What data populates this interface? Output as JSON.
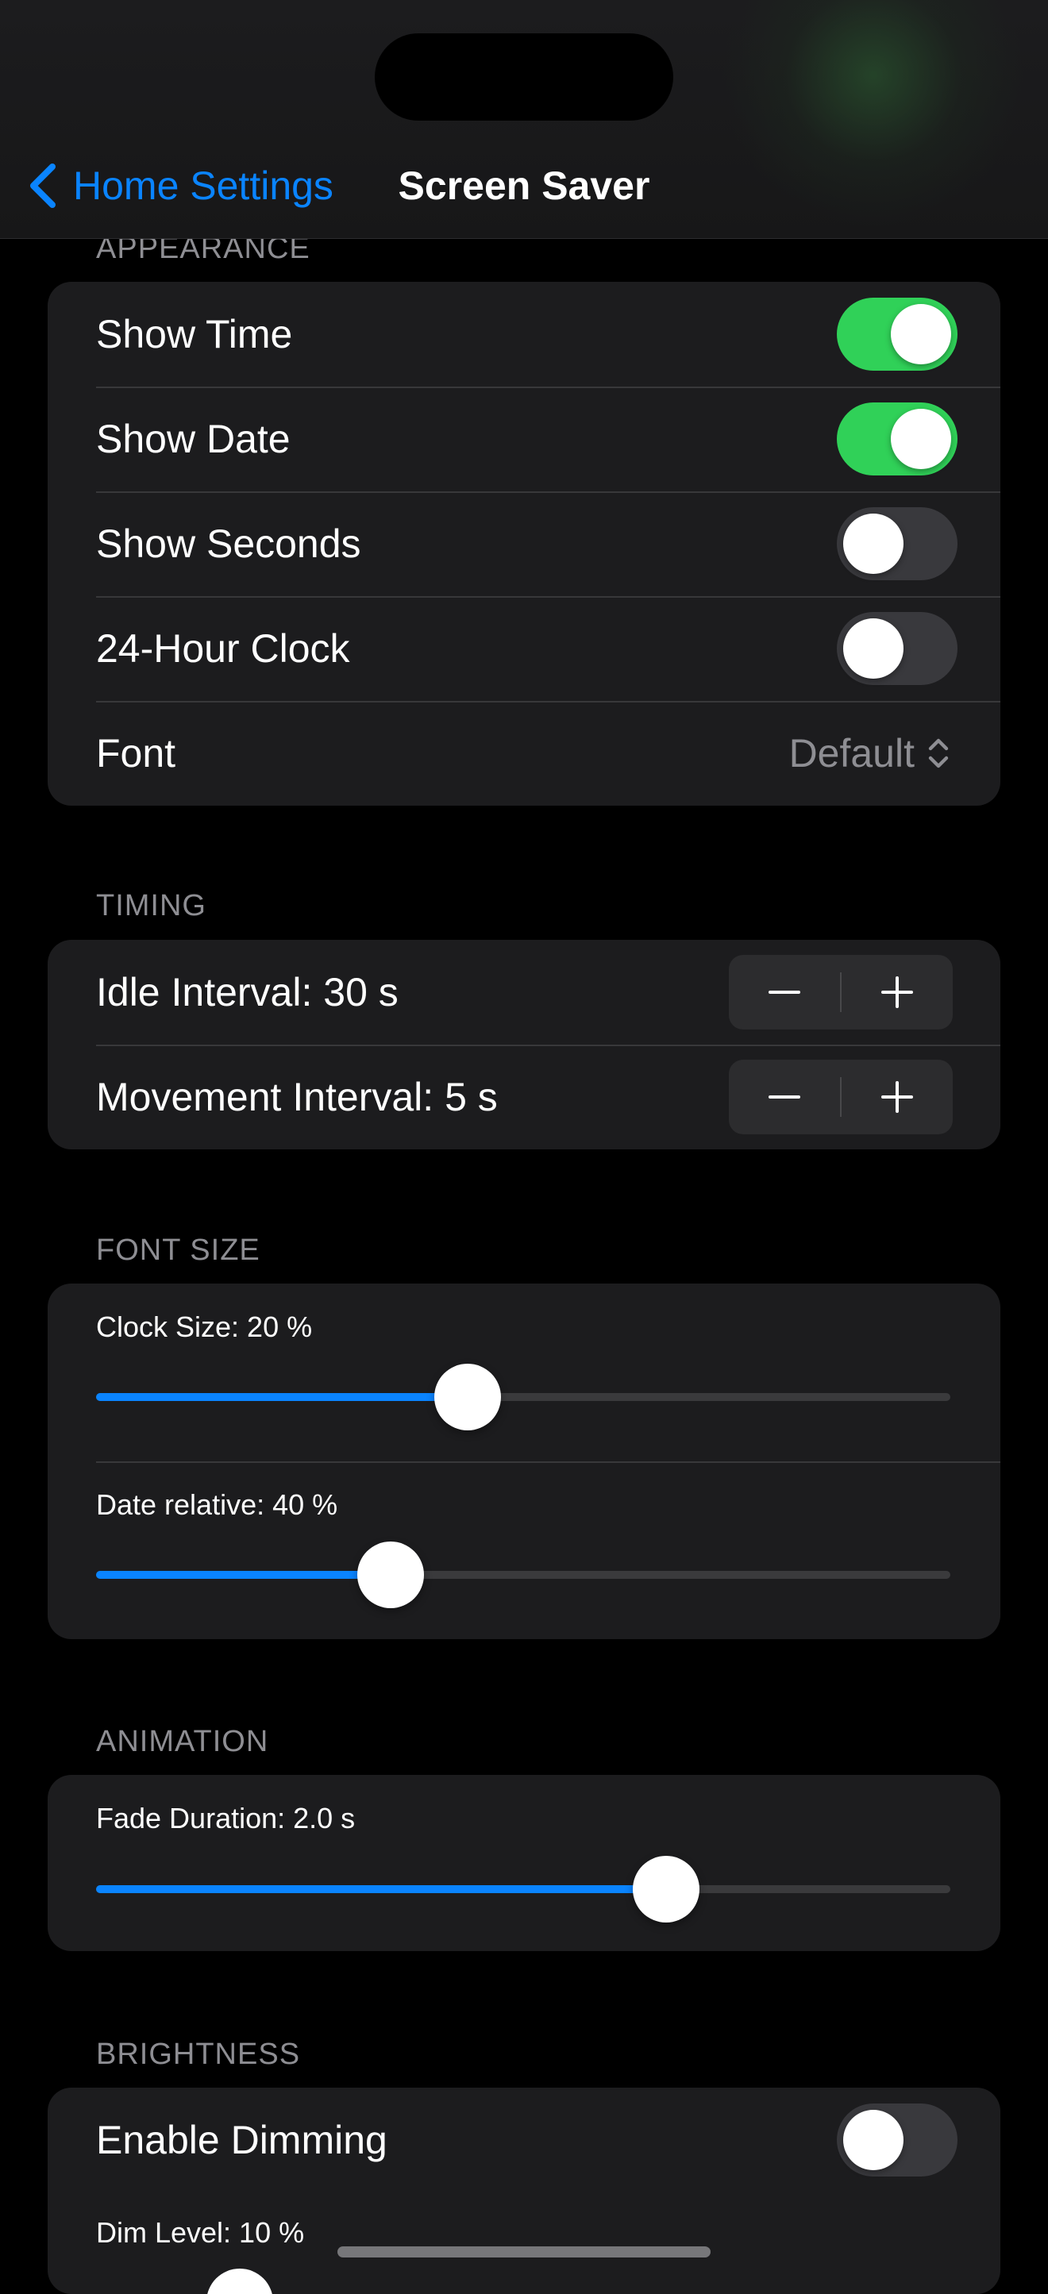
{
  "nav": {
    "back_label": "Home Settings",
    "title": "Screen Saver"
  },
  "appearance": {
    "header": "APPEARANCE",
    "rows": [
      {
        "label": "Show Time",
        "on": true
      },
      {
        "label": "Show Date",
        "on": true
      },
      {
        "label": "Show Seconds",
        "on": false
      },
      {
        "label": "24-Hour Clock",
        "on": false
      }
    ],
    "font": {
      "label": "Font",
      "value": "Default"
    }
  },
  "timing": {
    "header": "TIMING",
    "idle_label": "Idle Interval: 30 s",
    "movement_label": "Movement Interval: 5 s"
  },
  "font_size": {
    "header": "FONT SIZE",
    "clock_label": "Clock Size: 20 %",
    "clock_fraction": 0.435,
    "date_label": "Date relative: 40 %",
    "date_fraction": 0.345
  },
  "animation": {
    "header": "ANIMATION",
    "fade_label": "Fade Duration: 2.0 s",
    "fade_fraction": 0.667
  },
  "brightness": {
    "header": "BRIGHTNESS",
    "dimming_label": "Enable Dimming",
    "dimming_on": false,
    "dim_label": "Dim Level: 10 %"
  },
  "colors": {
    "accent": "#0a84ff",
    "toggle_on": "#30d158",
    "background": "#000000",
    "cell": "#1c1c1e"
  }
}
